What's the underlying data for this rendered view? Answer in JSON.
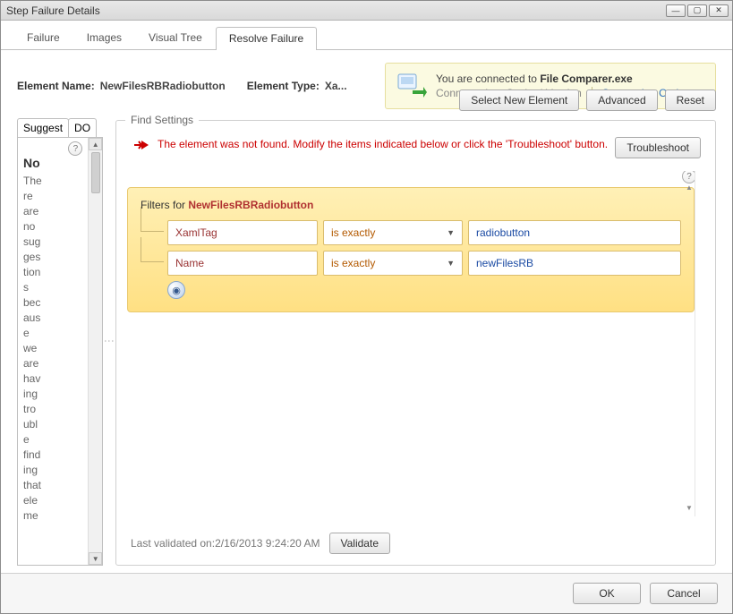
{
  "window": {
    "title": "Step Failure Details"
  },
  "tabs": {
    "failure": "Failure",
    "images": "Images",
    "visual_tree": "Visual Tree",
    "resolve": "Resolve Failure"
  },
  "header": {
    "element_name_label": "Element Name:",
    "element_name_value": "NewFilesRBRadiobutton",
    "element_type_label": "Element Type:",
    "element_type_value": "Xa..."
  },
  "connection": {
    "line1_prefix": "You are connected to ",
    "line1_app": "File Comparer.exe",
    "line2_prefix": "Connected to: ",
    "line2_value": "Cached Version",
    "options_link": "Connection Options"
  },
  "toolbar": {
    "select_new": "Select New Element",
    "advanced": "Advanced",
    "reset": "Reset"
  },
  "side": {
    "tab_suggest": "Suggest",
    "tab_do": "DO",
    "heading": "No",
    "text": "There are no suggestions because we are having trouble finding that element"
  },
  "find": {
    "legend": "Find Settings",
    "error_msg": "The element was not found. Modify the items indicated below or click the 'Troubleshoot' button.",
    "troubleshoot": "Troubleshoot",
    "filters_label_prefix": "Filters for ",
    "filters_label_target": "NewFilesRBRadiobutton",
    "rows": [
      {
        "name": "XamlTag",
        "op": "is exactly",
        "value": "radiobutton"
      },
      {
        "name": "Name",
        "op": "is exactly",
        "value": "newFilesRB"
      }
    ],
    "validated_label": "Last validated on: ",
    "validated_ts": "2/16/2013 9:24:20 AM",
    "validate_btn": "Validate"
  },
  "footer": {
    "ok": "OK",
    "cancel": "Cancel"
  }
}
